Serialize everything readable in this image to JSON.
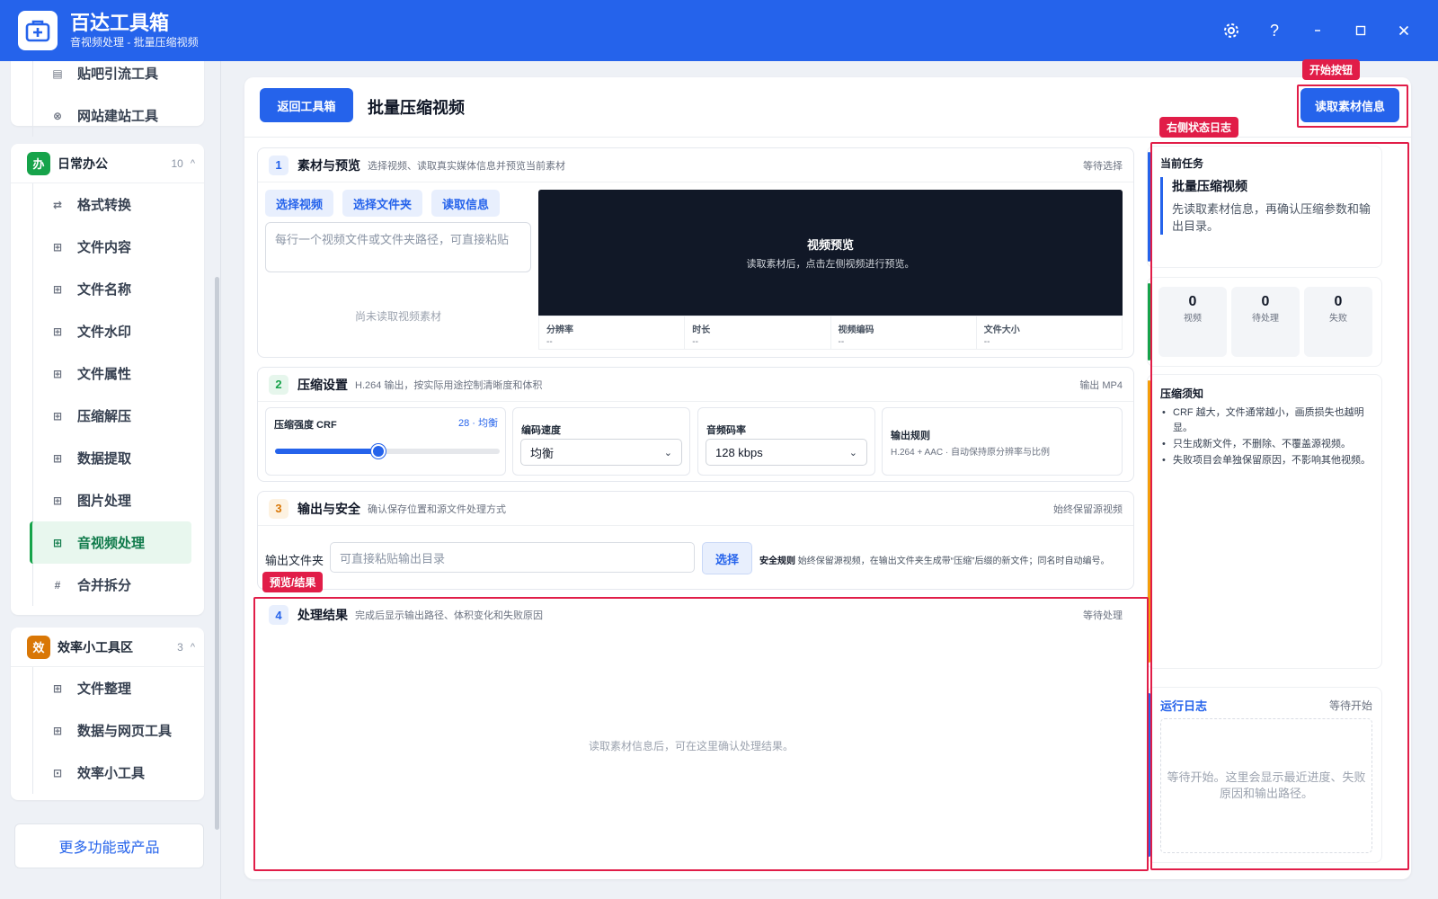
{
  "app": {
    "title": "百达工具箱",
    "subtitle": "音视频处理 - 批量压缩视频"
  },
  "sidebar": {
    "top_items": [
      {
        "label": "贴吧引流工具",
        "icon": "doc-icon"
      },
      {
        "label": "网站建站工具",
        "icon": "globe-icon"
      }
    ],
    "groups": [
      {
        "badge": "办",
        "badge_color": "#16a34a",
        "title": "日常办公",
        "count": "10",
        "items": [
          {
            "label": "格式转换",
            "icon": "swap-icon"
          },
          {
            "label": "文件内容",
            "icon": "grid-icon"
          },
          {
            "label": "文件名称",
            "icon": "grid-icon"
          },
          {
            "label": "文件水印",
            "icon": "grid-icon"
          },
          {
            "label": "文件属性",
            "icon": "grid-icon"
          },
          {
            "label": "压缩解压",
            "icon": "grid-icon"
          },
          {
            "label": "数据提取",
            "icon": "grid-icon"
          },
          {
            "label": "图片处理",
            "icon": "grid-icon"
          },
          {
            "label": "音视频处理",
            "icon": "grid-icon",
            "active": true
          },
          {
            "label": "合并拆分",
            "icon": "hash-icon"
          }
        ]
      },
      {
        "badge": "效",
        "badge_color": "#d97706",
        "title": "效率小工具区",
        "count": "3",
        "items": [
          {
            "label": "文件整理",
            "icon": "grid-icon"
          },
          {
            "label": "数据与网页工具",
            "icon": "grid-icon"
          },
          {
            "label": "效率小工具",
            "icon": "box-icon"
          }
        ]
      }
    ],
    "more_label": "更多功能或产品"
  },
  "main": {
    "back_label": "返回工具箱",
    "title": "批量压缩视频",
    "start_label": "读取素材信息",
    "sections": {
      "s1": {
        "num": "1",
        "title": "素材与预览",
        "desc": "选择视频、读取真实媒体信息并预览当前素材",
        "status": "等待选择",
        "buttons": [
          "选择视频",
          "选择文件夹",
          "读取信息"
        ],
        "textarea_placeholder": "每行一个视频文件或文件夹路径，可直接粘贴",
        "empty": "尚未读取视频素材",
        "preview_title": "视频预览",
        "preview_sub": "读取素材后，点击左侧视频进行预览。",
        "meta": [
          {
            "label": "分辨率",
            "value": "--"
          },
          {
            "label": "时长",
            "value": "--"
          },
          {
            "label": "视频编码",
            "value": "--"
          },
          {
            "label": "文件大小",
            "value": "--"
          }
        ]
      },
      "s2": {
        "num": "2",
        "title": "压缩设置",
        "desc": "H.264 输出，按实际用途控制清晰度和体积",
        "status": "输出 MP4",
        "crf_label": "压缩强度 CRF",
        "crf_value_text": "28 · 均衡",
        "crf_fraction": 0.46,
        "speed_label": "编码速度",
        "speed_value": "均衡",
        "audio_label": "音频码率",
        "audio_value": "128 kbps",
        "rule_label": "输出规则",
        "rule_text": "H.264 + AAC · 自动保持原分辨率与比例"
      },
      "s3": {
        "num": "3",
        "title": "输出与安全",
        "desc": "确认保存位置和源文件处理方式",
        "status": "始终保留源视频",
        "out_label": "输出文件夹",
        "out_placeholder": "可直接粘贴输出目录",
        "choose_label": "选择",
        "rule_bold": "安全规则",
        "rule_text": "始终保留源视频，在输出文件夹生成带“压缩”后缀的新文件；同名时自动编号。"
      },
      "s4": {
        "num": "4",
        "title": "处理结果",
        "desc": "完成后显示输出路径、体积变化和失败原因",
        "status": "等待处理",
        "empty": "读取素材信息后，可在这里确认处理结果。"
      }
    }
  },
  "right_panel": {
    "task": {
      "heading": "当前任务",
      "name": "批量压缩视频",
      "desc": "先读取素材信息，再确认压缩参数和输出目录。"
    },
    "stats": [
      {
        "value": "0",
        "label": "视频"
      },
      {
        "value": "0",
        "label": "待处理"
      },
      {
        "value": "0",
        "label": "失败"
      }
    ],
    "notes": {
      "heading": "压缩须知",
      "items": [
        "CRF 越大，文件通常越小，画质损失也越明显。",
        "只生成新文件，不删除、不覆盖源视频。",
        "失败项目会单独保留原因，不影响其他视频。"
      ]
    },
    "log": {
      "title": "运行日志",
      "status": "等待开始",
      "empty": "等待开始。这里会显示最近进度、失败原因和输出路径。"
    }
  },
  "annotations": {
    "start": "开始按钮",
    "right_log": "右侧状态日志",
    "preview_result": "预览/结果"
  },
  "colors": {
    "brand": "#2563eb",
    "annotation": "#e11d48",
    "active_green": "#16a34a"
  }
}
